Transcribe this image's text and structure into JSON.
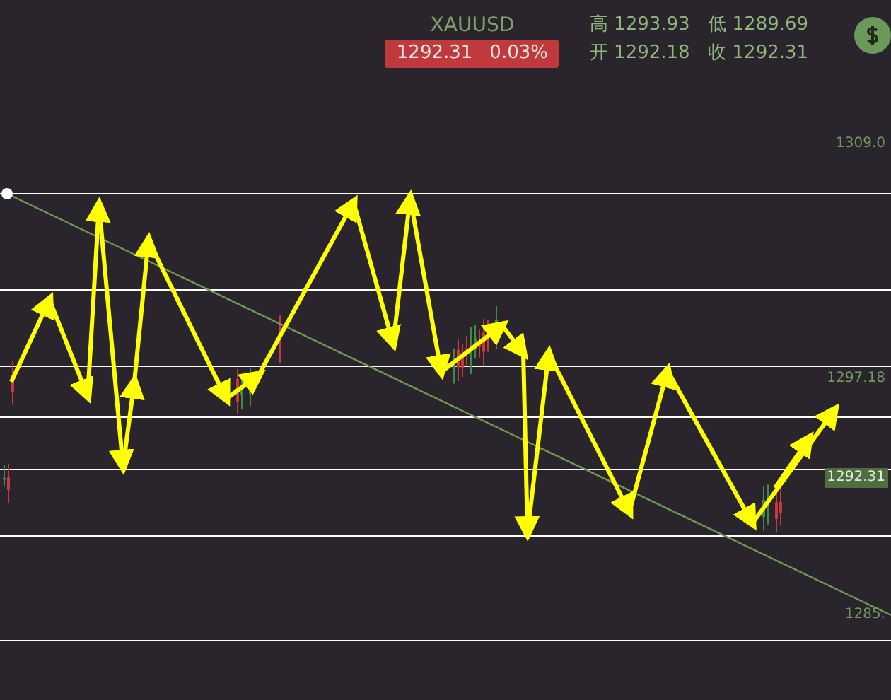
{
  "header": {
    "symbol": "XAUUSD",
    "price": "1292.31",
    "change": "0.03%",
    "falling": true,
    "stats": [
      {
        "label": "高",
        "value": "1293.93"
      },
      {
        "label": "低",
        "value": "1289.69"
      },
      {
        "label": "开",
        "value": "1292.18"
      },
      {
        "label": "收",
        "value": "1292.31"
      }
    ]
  },
  "axis_labels": [
    {
      "text": "1309.0",
      "kind": "tick"
    },
    {
      "text": "1297.18",
      "kind": "tick"
    },
    {
      "text": "1292.31",
      "kind": "current"
    },
    {
      "text": "1285.",
      "kind": "tick"
    }
  ]
}
